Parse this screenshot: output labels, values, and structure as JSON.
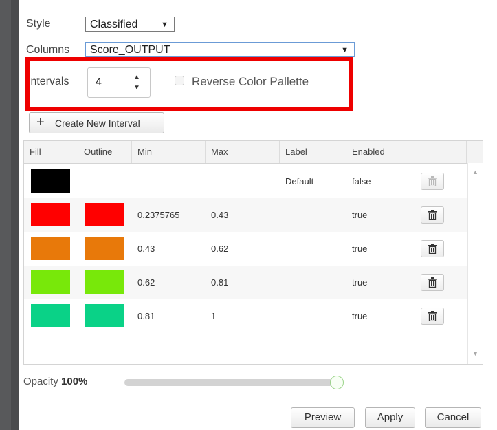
{
  "style": {
    "label": "Style",
    "value": "Classified"
  },
  "columns": {
    "label": "Columns",
    "value": "Score_OUTPUT"
  },
  "intervals": {
    "label": "Intervals",
    "value": "4"
  },
  "reverse_palette": {
    "label": "Reverse Color Pallette",
    "checked": false
  },
  "create_button": "Create New Interval",
  "table": {
    "headers": [
      "Fill",
      "Outline",
      "Min",
      "Max",
      "Label",
      "Enabled"
    ],
    "rows": [
      {
        "fill": "#000000",
        "outline": "",
        "min": "",
        "max": "",
        "label": "Default",
        "enabled": "false"
      },
      {
        "fill": "#ff0000",
        "outline": "#ff0000",
        "min": "0.2375765",
        "max": "0.43",
        "label": "",
        "enabled": "true"
      },
      {
        "fill": "#e8790a",
        "outline": "#e8790a",
        "min": "0.43",
        "max": "0.62",
        "label": "",
        "enabled": "true"
      },
      {
        "fill": "#78e80a",
        "outline": "#78e80a",
        "min": "0.62",
        "max": "0.81",
        "label": "",
        "enabled": "true"
      },
      {
        "fill": "#0ad287",
        "outline": "#0ad287",
        "min": "0.81",
        "max": "1",
        "label": "",
        "enabled": "true"
      }
    ]
  },
  "opacity": {
    "label": "Opacity",
    "value": "100%",
    "fraction": 1.0
  },
  "buttons": {
    "preview": "Preview",
    "apply": "Apply",
    "cancel": "Cancel"
  },
  "icons": {
    "trash": "trash-icon",
    "plus": "plus-icon"
  }
}
